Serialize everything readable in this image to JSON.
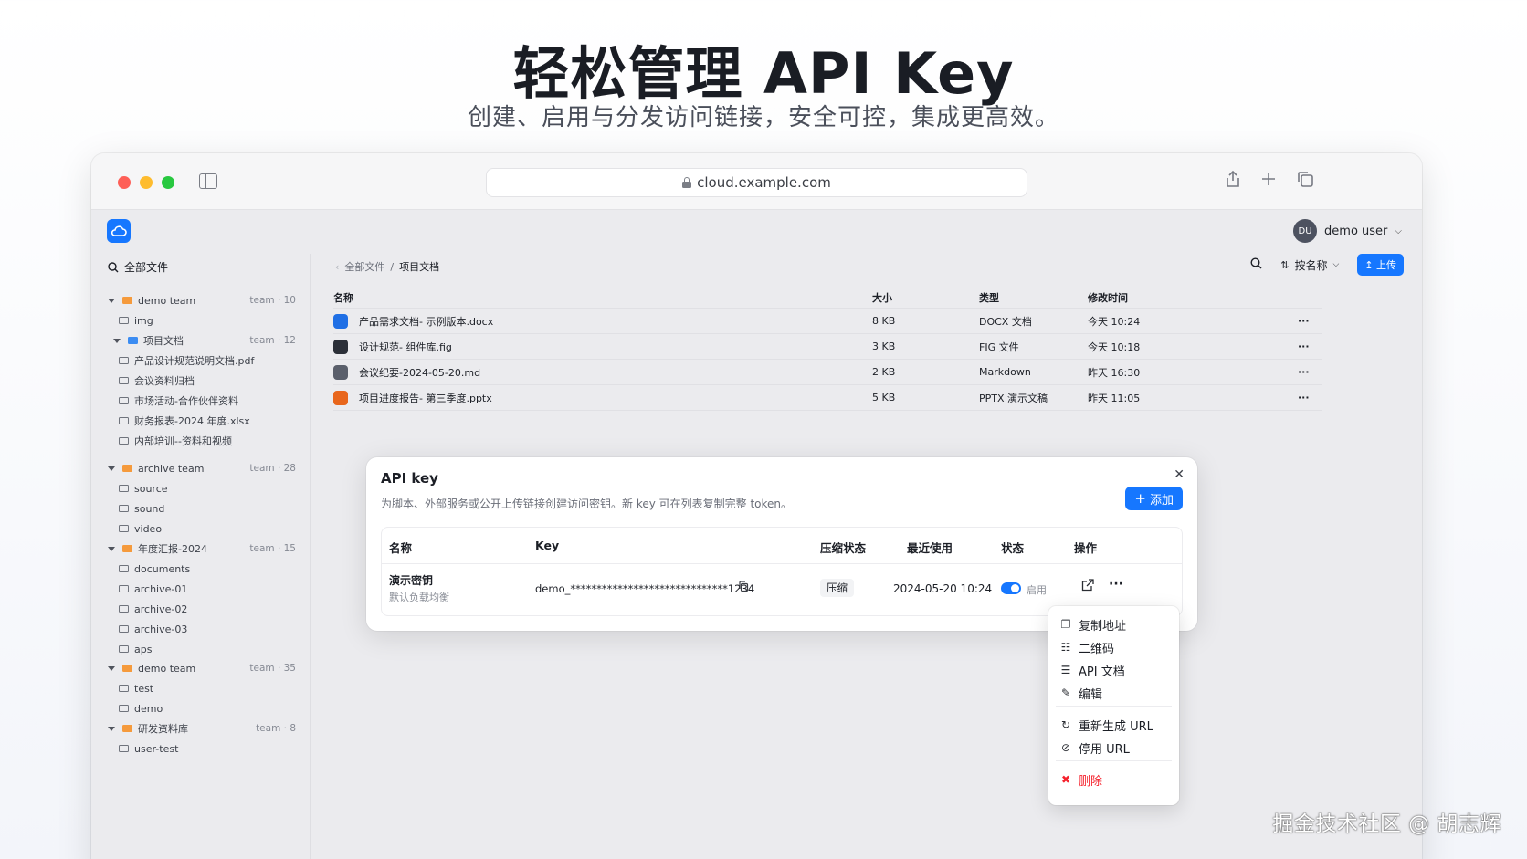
{
  "hero": {
    "title": "轻松管理 API Key",
    "subtitle": "创建、启用与分发访问链接，安全可控，集成更高效。"
  },
  "browser": {
    "url": "cloud.example.com",
    "icons": [
      "sidebar-icon",
      "share-icon",
      "plus-icon",
      "tabs-icon"
    ]
  },
  "header": {
    "user_initials": "DU",
    "user_name": "demo user"
  },
  "sidebar": {
    "all_files": "全部文件",
    "tree": [
      {
        "label": "demo team",
        "meta": "team · 10",
        "kind": "group",
        "color": "orange"
      },
      {
        "label": "img",
        "kind": "folder"
      },
      {
        "label": "项目文档",
        "meta": "team · 12",
        "kind": "group",
        "color": "blue"
      },
      {
        "label": "产品设计规范说明文档.pdf",
        "kind": "file"
      },
      {
        "label": "会议资料归档",
        "kind": "file"
      },
      {
        "label": "市场活动-合作伙伴资料",
        "kind": "file"
      },
      {
        "label": "财务报表-2024 年度.xlsx",
        "kind": "file"
      },
      {
        "label": "内部培训--资料和视频",
        "kind": "file"
      },
      {
        "label": "archive team",
        "meta": "team · 28",
        "kind": "group",
        "color": "orange"
      },
      {
        "label": "source",
        "kind": "folder"
      },
      {
        "label": "sound",
        "kind": "folder"
      },
      {
        "label": "video",
        "kind": "folder"
      },
      {
        "label": "年度汇报-2024",
        "meta": "team · 15",
        "kind": "group",
        "color": "orange"
      },
      {
        "label": "documents",
        "kind": "folder"
      },
      {
        "label": "archive-01",
        "kind": "folder"
      },
      {
        "label": "archive-02",
        "kind": "folder"
      },
      {
        "label": "archive-03",
        "kind": "folder"
      },
      {
        "label": "aps",
        "kind": "folder"
      },
      {
        "label": "demo team",
        "meta": "team · 35",
        "kind": "group",
        "color": "orange"
      },
      {
        "label": "test",
        "kind": "folder"
      },
      {
        "label": "demo",
        "kind": "folder"
      },
      {
        "label": "研发资料库",
        "meta": "team · 8",
        "kind": "group",
        "color": "orange"
      },
      {
        "label": "user-test",
        "kind": "folder"
      }
    ]
  },
  "main": {
    "breadcrumb_root": "全部文件",
    "breadcrumb_sep": "/",
    "breadcrumb_current": "项目文档",
    "sort_label": "按名称",
    "upload_label": "上传",
    "columns": {
      "name": "名称",
      "size": "大小",
      "type": "类型",
      "modified": "修改时间"
    },
    "files": [
      {
        "name": "产品需求文档- 示例版本.docx",
        "size": "8 KB",
        "type": "DOCX 文档",
        "modified": "今天 10:24",
        "color": "#1f6fe5"
      },
      {
        "name": "设计规范- 组件库.fig",
        "size": "3 KB",
        "type": "FIG 文件",
        "modified": "今天 10:18",
        "color": "#2b2f38"
      },
      {
        "name": "会议纪要-2024-05-20.md",
        "size": "2 KB",
        "type": "Markdown",
        "modified": "昨天 16:30",
        "color": "#5a5f6b"
      },
      {
        "name": "项目进度报告- 第三季度.pptx",
        "size": "5 KB",
        "type": "PPTX 演示文稿",
        "modified": "昨天 11:05",
        "color": "#e8661c"
      }
    ],
    "more_label": "···"
  },
  "dialog": {
    "title": "API key",
    "description": "为脚本、外部服务或公开上传链接创建访问密钥。新 key 可在列表复制完整 token。",
    "add_label": "添加",
    "columns": {
      "name": "名称",
      "key": "Key",
      "compress": "压缩状态",
      "last_used": "最近使用",
      "status": "状态",
      "actions": "操作"
    },
    "rows": [
      {
        "name": "演示密钥",
        "sub": "默认负载均衡",
        "key": "demo_******************************1234",
        "compress": "压缩",
        "last_used": "2024-05-20 10:24",
        "status": "启用",
        "enabled": true
      }
    ]
  },
  "menu": {
    "items": [
      {
        "label": "复制地址",
        "icon": "copy-icon"
      },
      {
        "label": "二维码",
        "icon": "qrcode-icon"
      },
      {
        "label": "API 文档",
        "icon": "doc-icon"
      },
      {
        "label": "编辑",
        "icon": "edit-icon"
      },
      {
        "label": "重新生成 URL",
        "icon": "refresh-icon"
      },
      {
        "label": "停用 URL",
        "icon": "link-off-icon"
      },
      {
        "label": "删除",
        "icon": "trash-icon",
        "danger": true
      }
    ]
  },
  "watermark": "掘金技术社区 @ 胡志辉",
  "colors": {
    "accent": "#1677ff",
    "danger": "#f5222d",
    "folder": "#f59a3c"
  }
}
